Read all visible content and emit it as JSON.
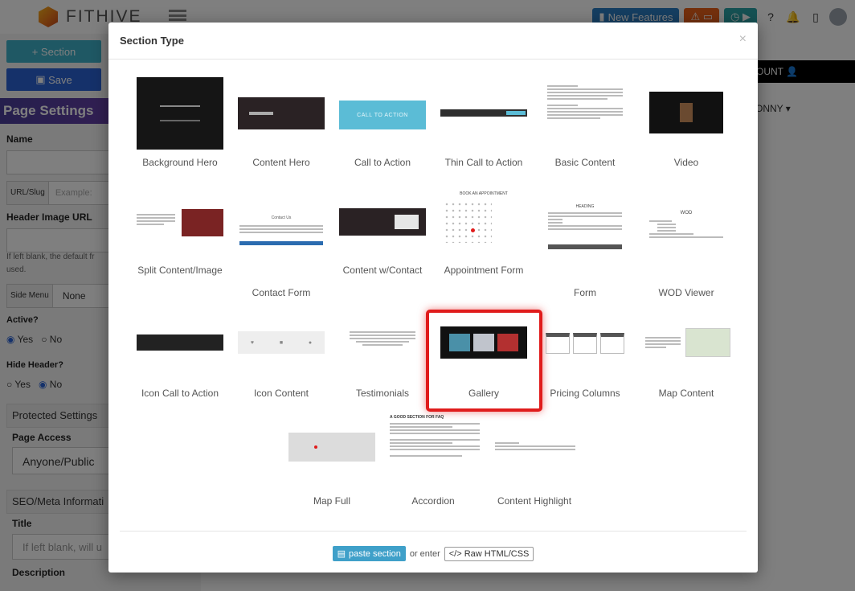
{
  "app": {
    "logo_text": "FITHIVE",
    "new_features_label": "New Features"
  },
  "sidebar": {
    "section_button": "Section",
    "save_button": "Save",
    "page_settings_title": "Page Settings",
    "name_label": "Name",
    "url_slug_label": "URL/Slug",
    "url_slug_placeholder": "Example:",
    "header_image_label": "Header Image URL",
    "header_image_note": "If left blank, the default fr",
    "header_image_note2": "used.",
    "side_menu_label": "Side Menu",
    "side_menu_value": "None",
    "active_label": "Active?",
    "active_yes": "Yes",
    "active_no": "No",
    "hide_header_label": "Hide Header?",
    "hide_header_yes": "Yes",
    "hide_header_no": "No",
    "protected_settings": "Protected Settings",
    "page_access_label": "Page Access",
    "page_access_value": "Anyone/Public",
    "seo_label": "SEO/Meta Informati",
    "title_label": "Title",
    "title_placeholder": "If left blank, will u",
    "description_label": "Description"
  },
  "right": {
    "account_label": "OUNT",
    "user_label": "ONNY"
  },
  "modal": {
    "title": "Section Type",
    "close": "×",
    "sections": [
      {
        "label": "Background Hero"
      },
      {
        "label": "Content Hero"
      },
      {
        "label": "Call to Action"
      },
      {
        "label": "Thin Call to Action"
      },
      {
        "label": "Basic Content"
      },
      {
        "label": "Video"
      },
      {
        "label": "Split Content/Image"
      },
      {
        "label": "Contact Form"
      },
      {
        "label": "Content w/Contact"
      },
      {
        "label": "Appointment Form"
      },
      {
        "label": "Form"
      },
      {
        "label": "WOD Viewer"
      },
      {
        "label": "Icon Call to Action"
      },
      {
        "label": "Icon Content"
      },
      {
        "label": "Testimonials"
      },
      {
        "label": "Gallery"
      },
      {
        "label": "Pricing Columns"
      },
      {
        "label": "Map Content"
      },
      {
        "label": "Map Full"
      },
      {
        "label": "Accordion"
      },
      {
        "label": "Content Highlight"
      }
    ],
    "selected": "Gallery",
    "thumb_text": {
      "cta": "CALL TO ACTION",
      "appointment": "BOOK AN APPOINTMENT",
      "form": "HEADING",
      "wod": "WOD",
      "accordion": "A GOOD SECTION FOR FAQ",
      "contact": "Contact Us"
    },
    "footer": {
      "paste_label": "paste section",
      "or_enter": "or enter",
      "raw_label": "Raw HTML/CSS"
    }
  },
  "colors": {
    "selected_border": "#e01c1c",
    "paste_button": "#3fa0c9",
    "section_button": "#3fb0c9",
    "save_button": "#2a63d4"
  }
}
